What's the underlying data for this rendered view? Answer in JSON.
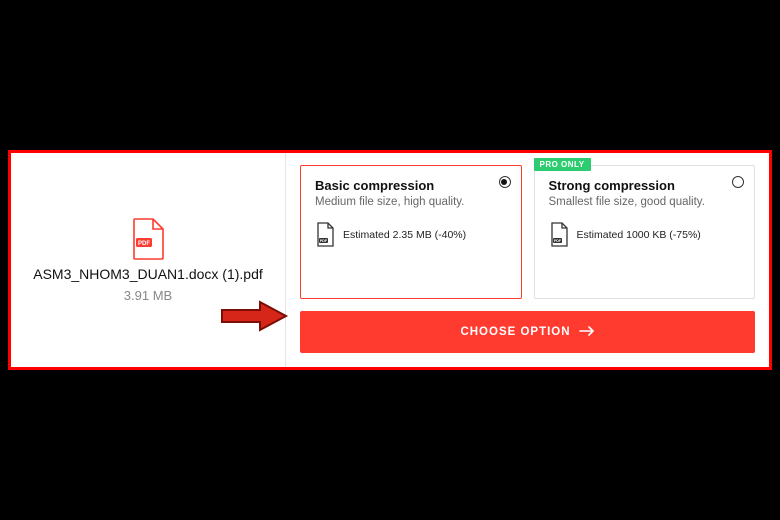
{
  "file": {
    "name": "ASM3_NHOM3_DUAN1.docx (1).pdf",
    "size": "3.91 MB"
  },
  "options": {
    "basic": {
      "title": "Basic compression",
      "desc": "Medium file size, high quality.",
      "estimated": "Estimated 2.35 MB (-40%)",
      "selected": true
    },
    "strong": {
      "title": "Strong compression",
      "desc": "Smallest file size, good quality.",
      "estimated": "Estimated 1000 KB (-75%)",
      "badge": "PRO ONLY",
      "selected": false
    }
  },
  "button": {
    "label": "CHOOSE OPTION"
  },
  "colors": {
    "accent": "#ff3b30",
    "pro": "#2ecc71"
  }
}
